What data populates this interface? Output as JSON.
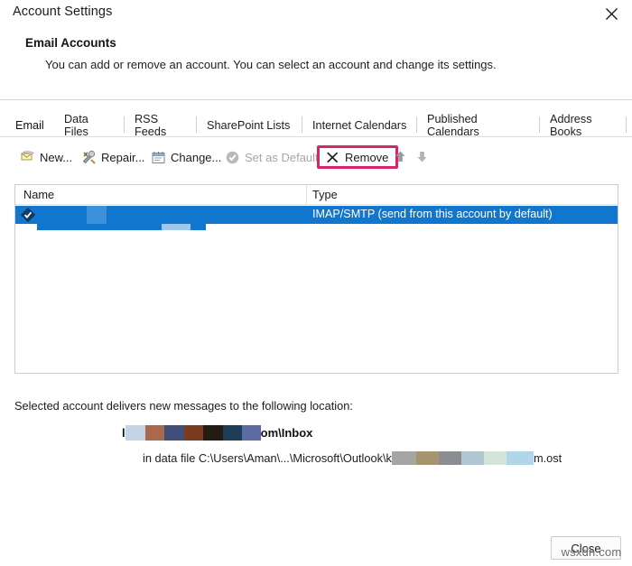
{
  "window": {
    "title": "Account Settings",
    "close_icon": "close-x-icon"
  },
  "header": {
    "title": "Email Accounts",
    "description": "You can add or remove an account. You can select an account and change its settings."
  },
  "tabs": [
    {
      "label": "Email",
      "selected": true
    },
    {
      "label": "Data Files",
      "selected": false
    },
    {
      "label": "RSS Feeds",
      "selected": false
    },
    {
      "label": "SharePoint Lists",
      "selected": false
    },
    {
      "label": "Internet Calendars",
      "selected": false
    },
    {
      "label": "Published Calendars",
      "selected": false
    },
    {
      "label": "Address Books",
      "selected": false
    }
  ],
  "toolbar": {
    "new_label": "New...",
    "repair_label": "Repair...",
    "change_label": "Change...",
    "set_default_label": "Set as Default",
    "remove_label": "Remove",
    "move_up_icon": "arrow-up-icon",
    "move_down_icon": "arrow-down-icon",
    "highlight_color": "#d9246b"
  },
  "accounts_list": {
    "columns": [
      "Name",
      "Type"
    ],
    "rows": [
      {
        "name": "",
        "type": "IMAP/SMTP (send from this account by default)",
        "selected": true,
        "selection_color": "#1176ce"
      }
    ]
  },
  "delivery": {
    "label": "Selected account delivers new messages to the following location:",
    "path_prefix": "l",
    "path_suffix": "om\\Inbox",
    "file_prefix": "in data file C:\\Users\\Aman\\...\\Microsoft\\Outlook\\k",
    "file_suffix": "m.ost"
  },
  "footer": {
    "close_label": "Close"
  },
  "watermark": {
    "text": "wsxdn.com"
  }
}
